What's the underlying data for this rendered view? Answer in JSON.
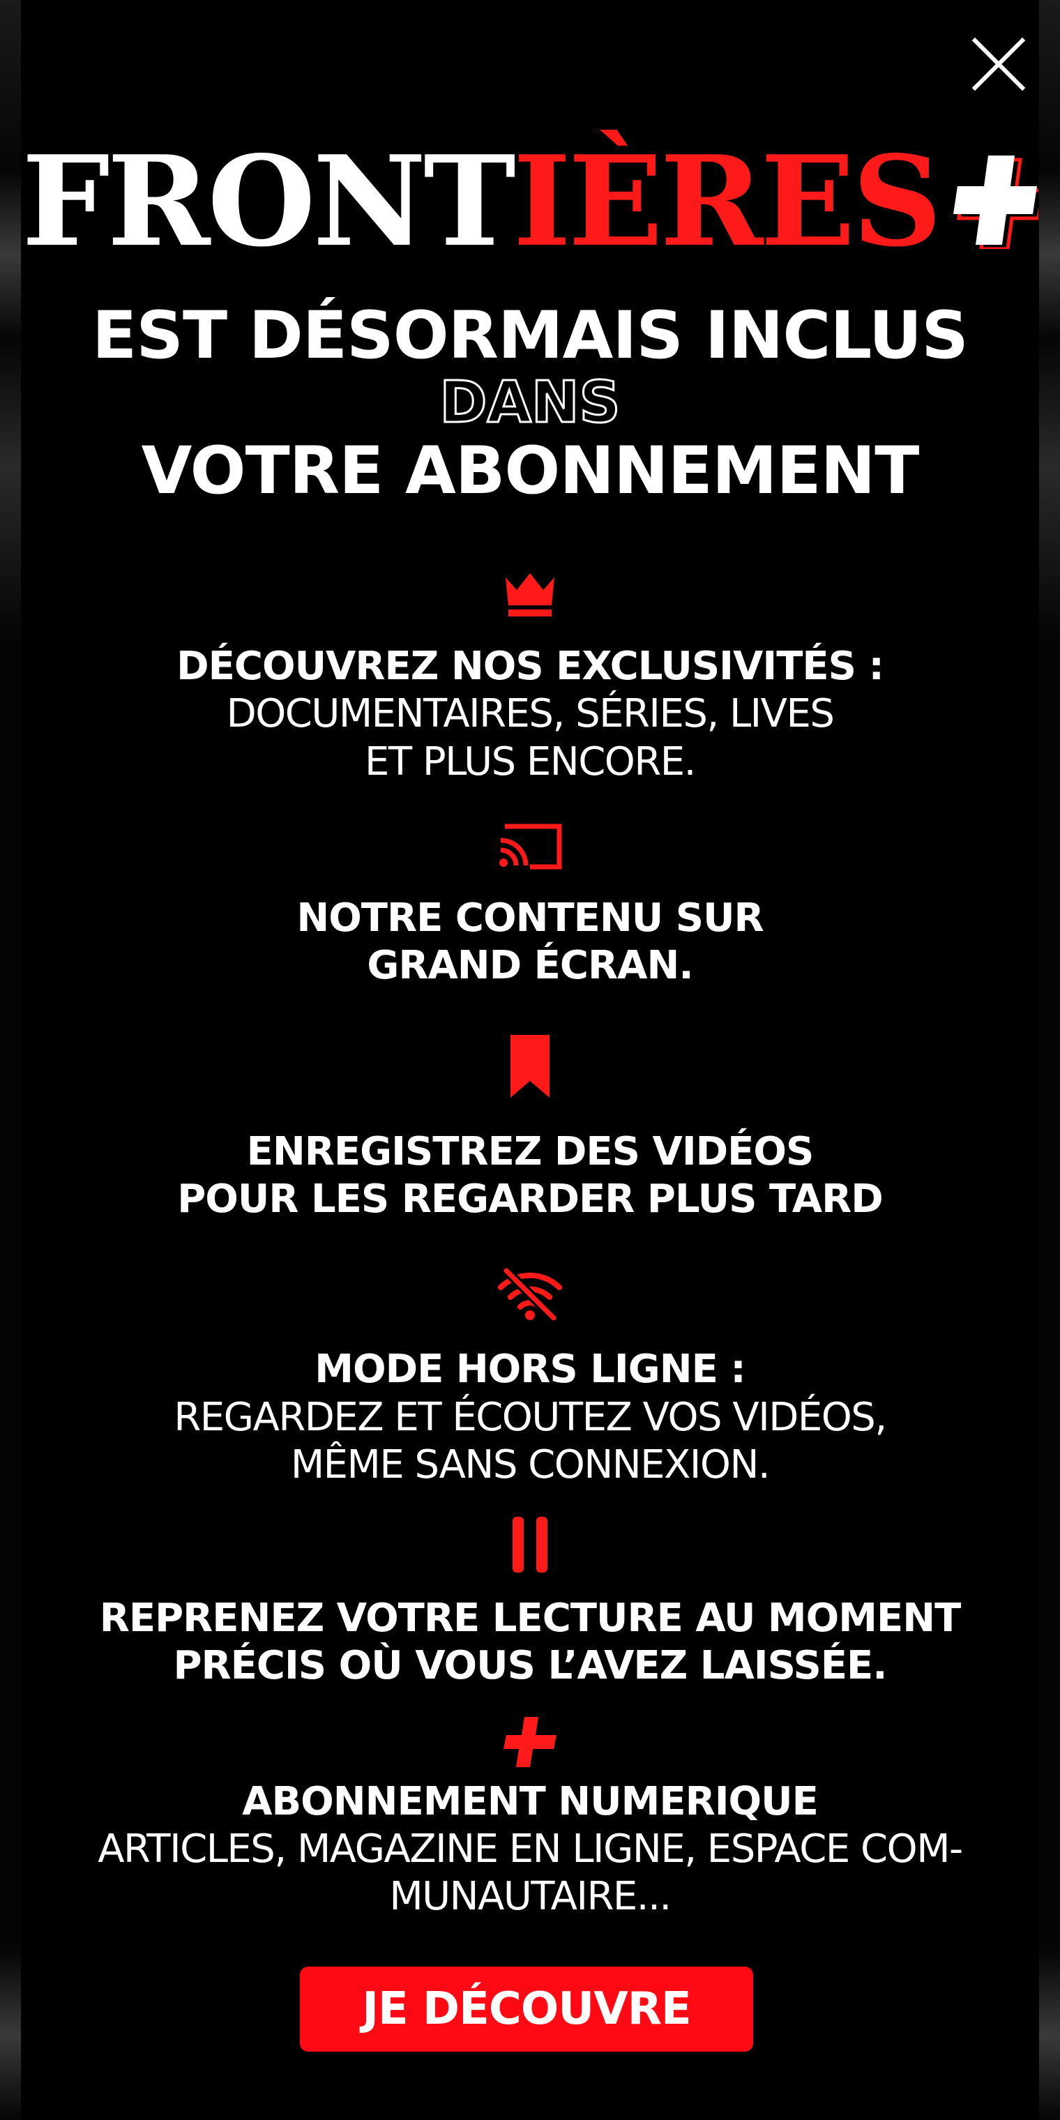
{
  "brand": {
    "logo_white": "FRONT",
    "logo_red": "IÈRES",
    "accent_color": "#ff1a1a"
  },
  "headline": {
    "line1": "EST DÉSORMAIS INCLUS",
    "line2": "DANS",
    "line3": "VOTRE ABONNEMENT"
  },
  "features": [
    {
      "icon": "crown-icon",
      "title": "DÉCOUVREZ NOS EXCLUSIVITÉS :",
      "desc": "DOCUMENTAIRES, SÉRIES, LIVES\nET PLUS ENCORE."
    },
    {
      "icon": "cast-icon",
      "title": "NOTRE CONTENU SUR\nGRAND ÉCRAN.",
      "desc": ""
    },
    {
      "icon": "bookmark-icon",
      "title": "ENREGISTREZ DES VIDÉOS\nPOUR LES REGARDER PLUS TARD",
      "desc": ""
    },
    {
      "icon": "wifi-off-icon",
      "title": "MODE HORS LIGNE :",
      "desc": "REGARDEZ ET ÉCOUTEZ VOS VIDÉOS,\nMÊME SANS CONNEXION."
    },
    {
      "icon": "pause-icon",
      "title": "REPRENEZ VOTRE LECTURE AU MOMENT\nPRÉCIS OÙ VOUS L’AVEZ LAISSÉE.",
      "desc": ""
    },
    {
      "icon": "plus-icon",
      "title": "ABONNEMENT NUMERIQUE",
      "desc": "ARTICLES, MAGAZINE EN LIGNE, ESPACE COM-\nMUNAUTAIRE..."
    }
  ],
  "cta": {
    "label": "JE DÉCOUVRE",
    "color": "#ff0a14"
  },
  "close": {
    "icon": "close-icon"
  }
}
